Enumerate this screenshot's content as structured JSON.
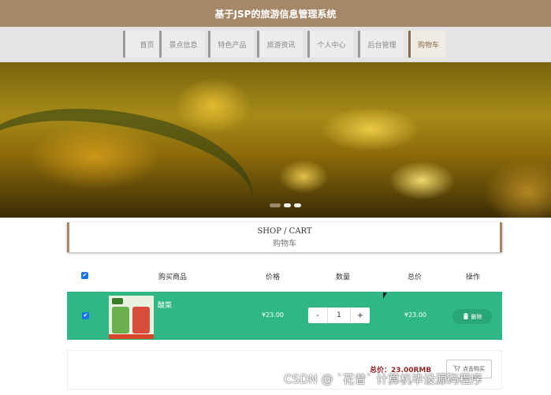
{
  "header": {
    "title": "基于JSP的旅游信息管理系统"
  },
  "nav": {
    "items": [
      {
        "label": "首页"
      },
      {
        "label": "景点信息"
      },
      {
        "label": "特色产品"
      },
      {
        "label": "旅游资讯"
      },
      {
        "label": "个人中心"
      },
      {
        "label": "后台管理"
      },
      {
        "label": "购物车"
      }
    ],
    "active_index": 6
  },
  "carousel": {
    "slide_count": 3,
    "active_index": 0
  },
  "section": {
    "title_en": "SHOP / CART",
    "title_zh": "购物车"
  },
  "table": {
    "columns": [
      "购买商品",
      "价格",
      "数量",
      "总价",
      "操作"
    ],
    "select_all_checked": true,
    "rows": [
      {
        "checked": true,
        "name": "酸菜",
        "price": "¥23.00",
        "quantity": "1",
        "minus": "-",
        "plus": "+",
        "total": "¥23.00",
        "delete_label": "删除"
      }
    ]
  },
  "summary": {
    "total_label": "总价：23.00RMB",
    "checkout_label": "点击购买"
  },
  "watermark": "CSDN @ `花昔` 计算机毕设源码程序",
  "colors": {
    "brand": "#a48868",
    "row_highlight": "#2fb786",
    "total_text": "#8a2a2a"
  }
}
